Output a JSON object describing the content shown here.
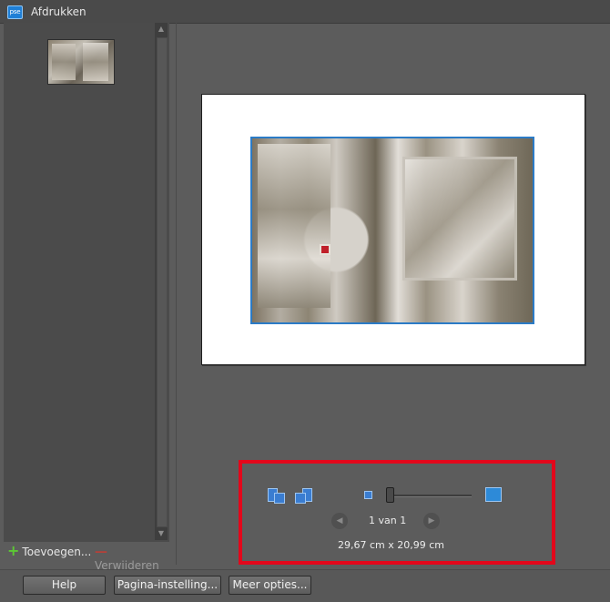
{
  "window": {
    "title": "Afdrukken",
    "app_icon_label": "pse"
  },
  "left_panel": {
    "add_label": "Toevoegen...",
    "remove_label": "Verwijderen"
  },
  "preview": {
    "page_indicator": "1 van 1",
    "page_size": "29,67 cm x 20,99 cm",
    "zoom_level": 0.0
  },
  "buttons": {
    "help": "Help",
    "page_setup": "Pagina-instelling...",
    "more_options": "Meer opties..."
  },
  "colors": {
    "highlight_border": "#e3071b",
    "selection_border": "#2b7bc6"
  },
  "icons": {
    "rotate_left": "rotate-left-icon",
    "rotate_right": "rotate-right-icon",
    "zoom_out": "zoom-small-icon",
    "zoom_in": "zoom-large-icon",
    "prev_page": "chevron-left-icon",
    "next_page": "chevron-right-icon",
    "add": "plus-icon",
    "remove": "minus-icon"
  }
}
